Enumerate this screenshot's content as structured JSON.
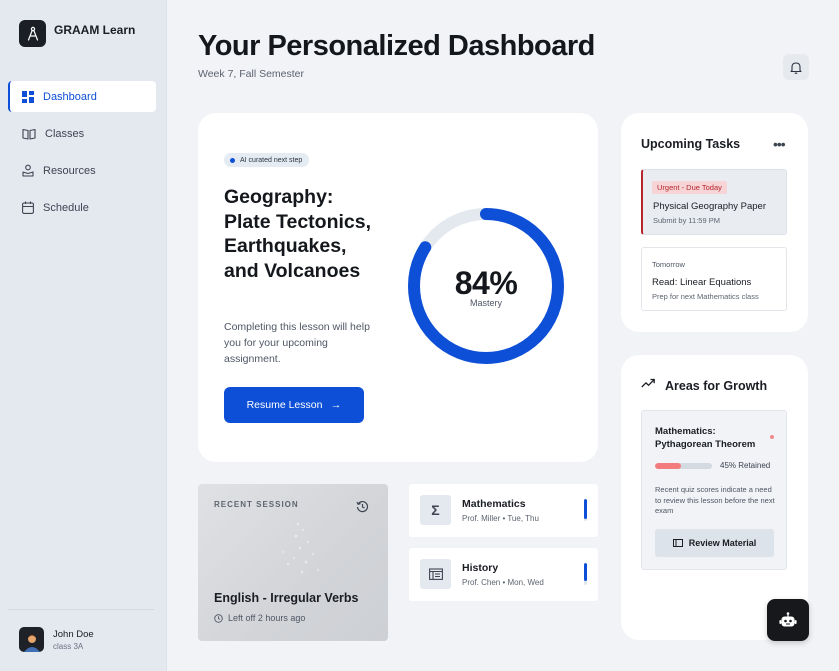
{
  "app": {
    "name": "GRAAM Learn"
  },
  "sidebar": {
    "items": [
      {
        "label": "Dashboard",
        "icon": "grid-icon",
        "active": true
      },
      {
        "label": "Classes",
        "icon": "book-open-icon"
      },
      {
        "label": "Resources",
        "icon": "user-resources-icon"
      },
      {
        "label": "Schedule",
        "icon": "calendar-icon"
      }
    ],
    "user": {
      "name": "John Doe",
      "class": "class 3A"
    }
  },
  "header": {
    "title": "Your Personalized Dashboard",
    "subtitle": "Week 7, Fall Semester"
  },
  "hero": {
    "badge": "AI curated next step",
    "title": "Geography: Plate Tectonics, Earthquakes, and Volcanoes",
    "description": "Completing this lesson will help you for your upcoming assignment.",
    "button": "Resume Lesson",
    "mastery_value": "84%",
    "mastery_fraction": 0.84,
    "mastery_label": "Mastery"
  },
  "recent": {
    "label": "RECENT SESSION",
    "title": "English - Irregular Verbs",
    "time": "Left off 2 hours ago"
  },
  "classes": [
    {
      "name": "Mathematics",
      "meta": "Prof. Miller • Tue, Thu",
      "icon": "sigma-icon",
      "progress": 0.9
    },
    {
      "name": "History",
      "meta": "Prof. Chen • Mon, Wed",
      "icon": "history-book-icon",
      "progress": 0.8
    }
  ],
  "tasks": {
    "title": "Upcoming Tasks",
    "items": [
      {
        "badge": "Urgent - Due Today",
        "name": "Physical Geography Paper",
        "sub": "Submit by 11:59 PM"
      },
      {
        "when": "Tomorrow",
        "name": "Read: Linear Equations",
        "sub": "Prep for next Mathematics class"
      }
    ]
  },
  "growth": {
    "title": "Areas for Growth",
    "item": {
      "title": "Mathematics: Pythagorean Theorem",
      "retained_text": "45% Retained",
      "retained_fraction": 0.45,
      "description": "Recent quiz scores indicate a need to review this lesson before the next exam",
      "button": "Review Material"
    }
  },
  "colors": {
    "accent": "#0d4fd6",
    "urgent": "#b3262d",
    "retention": "#f37b7d"
  }
}
